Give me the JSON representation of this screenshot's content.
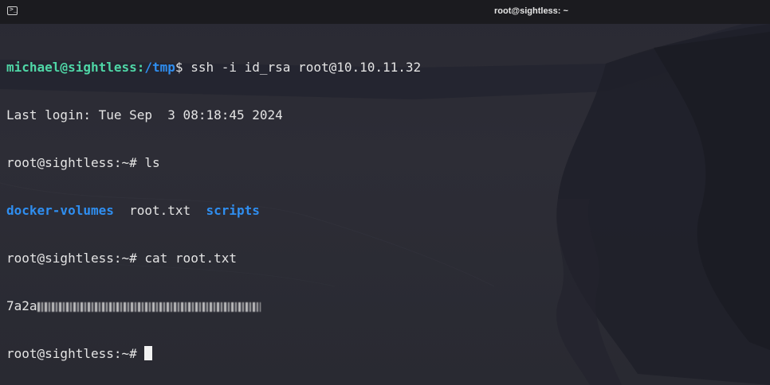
{
  "window": {
    "title": "root@sightless: ~"
  },
  "terminal": {
    "line1": {
      "user_host": "michael@sightless:",
      "path": "/tmp",
      "prompt_symbol": "$",
      "command": " ssh -i id_rsa root@10.10.11.32"
    },
    "line2": "Last login: Tue Sep  3 08:18:45 2024",
    "line3": {
      "prompt": "root@sightless:~# ",
      "command": "ls"
    },
    "line4": {
      "items": [
        "docker-volumes",
        "root.txt",
        "scripts"
      ]
    },
    "line5": {
      "prompt": "root@sightless:~# ",
      "command": "cat root.txt"
    },
    "line6": {
      "visible_prefix": "7a2a"
    },
    "line7": {
      "prompt": "root@sightless:~# "
    }
  },
  "colors": {
    "prompt_green": "#4fd6a6",
    "path_blue": "#2f8ef0",
    "titlebar": "#1b1b1f",
    "background": "#2a2a33"
  },
  "icons": [
    "terminal-icon",
    "background-wallpaper"
  ]
}
